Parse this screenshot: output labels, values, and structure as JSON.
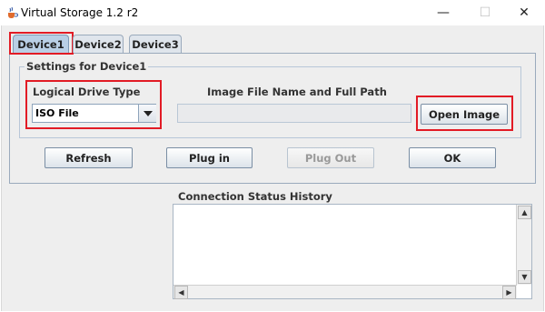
{
  "window": {
    "title": "Virtual Storage 1.2 r2",
    "minimize_glyph": "—",
    "maximize_glyph": "☐",
    "close_glyph": "✕",
    "app_icon": "java-cup-icon"
  },
  "tabs": [
    {
      "label": "Device1",
      "active": true
    },
    {
      "label": "Device2",
      "active": false
    },
    {
      "label": "Device3",
      "active": false
    }
  ],
  "settings": {
    "group_title": "Settings for Device1",
    "drive_type_label": "Logical Drive Type",
    "drive_type_value": "ISO File",
    "image_path_label": "Image File Name and Full Path",
    "image_path_value": "",
    "open_image_label": "Open Image"
  },
  "actions": {
    "refresh": "Refresh",
    "plug_in": "Plug in",
    "plug_out": "Plug Out",
    "ok": "OK"
  },
  "status": {
    "title": "Connection Status History",
    "content": ""
  },
  "colors": {
    "highlight_border": "#e21b25",
    "tab_active": "#b9cfe5",
    "background": "#eeeeee"
  }
}
